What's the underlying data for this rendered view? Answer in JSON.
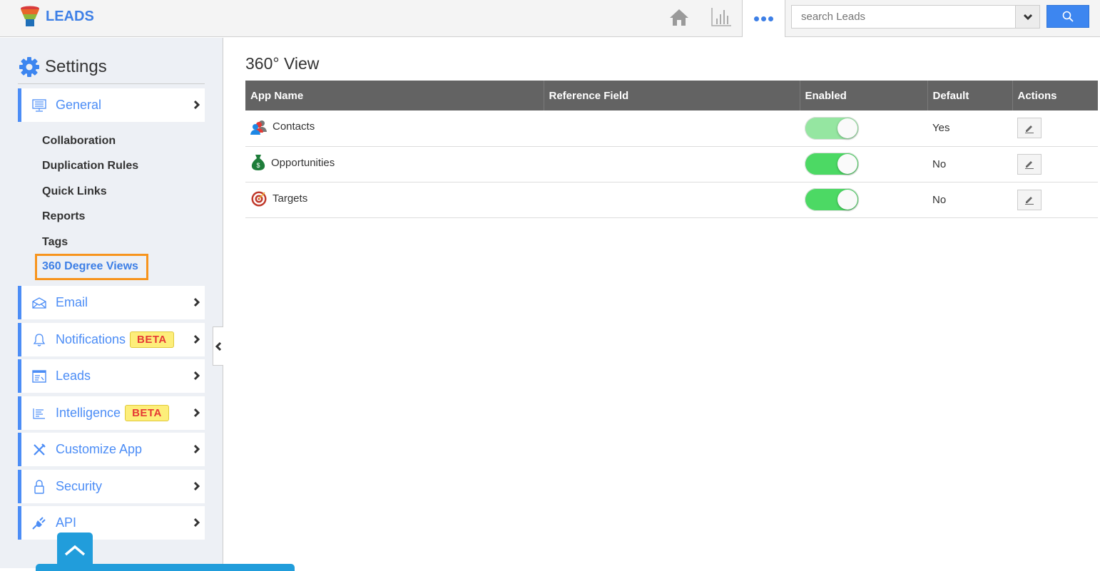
{
  "header": {
    "app_name": "LEADS",
    "search": {
      "placeholder": "search Leads"
    },
    "icons": [
      "home-icon",
      "chart-icon",
      "more-icon",
      "chevron-down-icon",
      "search-icon"
    ]
  },
  "colors": {
    "accent": "#3d7fe6",
    "highlight": "#f7941d",
    "toggle_on": "#4cd964",
    "toggle_on_light": "#95e6a1",
    "table_header": "#636363"
  },
  "sidebar": {
    "title": "Settings",
    "general": {
      "label": "General",
      "subitems": [
        "Collaboration",
        "Duplication Rules",
        "Quick Links",
        "Reports",
        "Tags"
      ],
      "active": "360 Degree Views"
    },
    "items": [
      {
        "label": "Email",
        "icon": "envelope-icon"
      },
      {
        "label": "Notifications",
        "icon": "bell-icon",
        "badge": "BETA"
      },
      {
        "label": "Leads",
        "icon": "leads-icon"
      },
      {
        "label": "Intelligence",
        "icon": "lines-icon",
        "badge": "BETA"
      },
      {
        "label": "Customize App",
        "icon": "tools-icon"
      },
      {
        "label": "Security",
        "icon": "lock-icon"
      },
      {
        "label": "API",
        "icon": "plug-icon"
      }
    ]
  },
  "main": {
    "title": "360° View",
    "columns": [
      "App Name",
      "Reference Field",
      "Enabled",
      "Default",
      "Actions"
    ],
    "rows": [
      {
        "app": "Contacts",
        "reference": "",
        "enabled": true,
        "default": "Yes"
      },
      {
        "app": "Opportunities",
        "reference": "",
        "enabled": true,
        "default": "No"
      },
      {
        "app": "Targets",
        "reference": "",
        "enabled": true,
        "default": "No"
      }
    ]
  }
}
